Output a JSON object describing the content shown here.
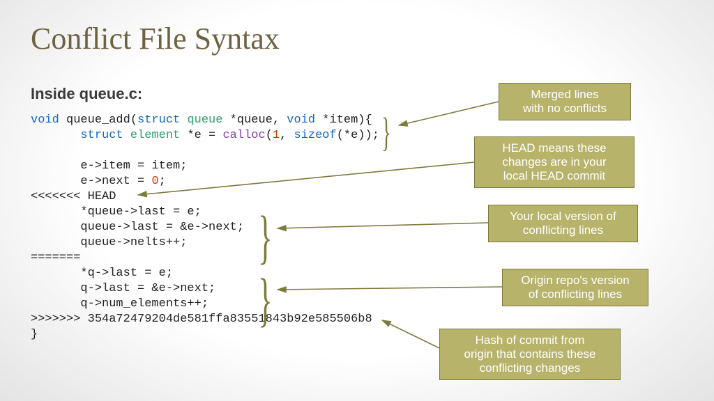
{
  "title": "Conflict File Syntax",
  "subtitle": "Inside queue.c:",
  "code": {
    "l1a": "void",
    "l1b": " queue_add(",
    "l1c": "struct",
    "l1d": " queue ",
    "l1e": "*queue, ",
    "l1f": "void",
    "l1g": " *item){",
    "l2a": "       struct",
    "l2b": " element ",
    "l2c": "*e = ",
    "l2d": "calloc",
    "l2e": "(",
    "l2f": "1",
    "l2g": ", ",
    "l2h": "sizeof",
    "l2i": "(*e));",
    "l3": "",
    "l4": "       e->item = item;",
    "l5a": "       e->next = ",
    "l5b": "0",
    "l5c": ";",
    "l6": "<<<<<<< HEAD",
    "l7": "       *queue->last = e;",
    "l8": "       queue->last = &e->next;",
    "l9": "       queue->nelts++;",
    "l10": "=======",
    "l11": "       *q->last = e;",
    "l12": "       q->last = &e->next;",
    "l13": "       q->num_elements++;",
    "l14": ">>>>>>> 354a72479204de581ffa83551843b92e585506b8",
    "l15": "}"
  },
  "callouts": {
    "merged": "Merged lines\nwith no conflicts",
    "head": "HEAD means these\nchanges are in your\nlocal HEAD commit",
    "local": "Your local version of\nconflicting lines",
    "origin": "Origin repo's version\nof conflicting lines",
    "hash": "Hash of commit from\norigin that contains these\nconflicting changes"
  }
}
